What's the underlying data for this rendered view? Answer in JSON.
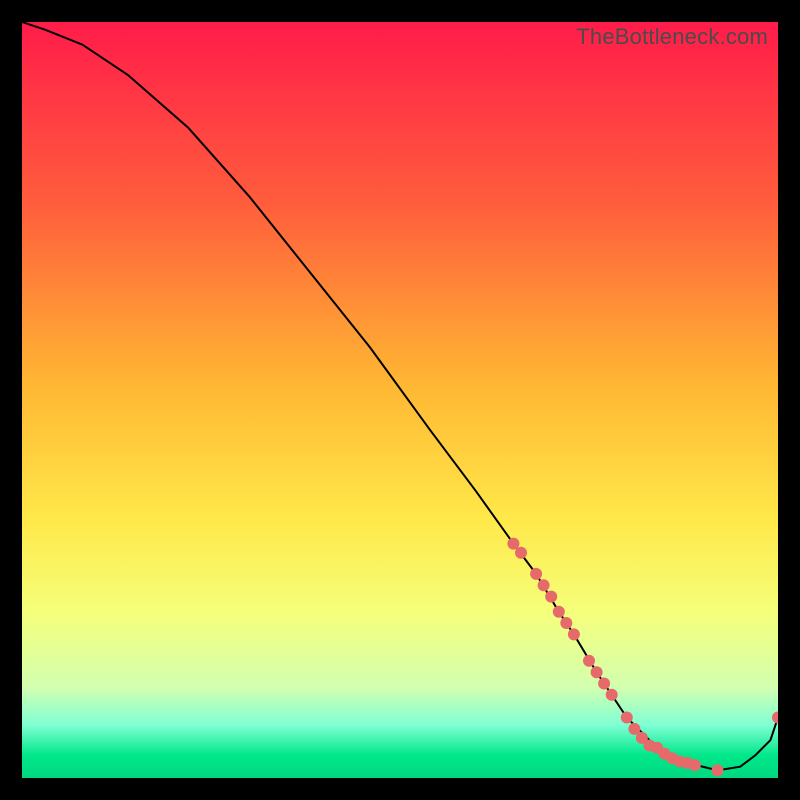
{
  "watermark": "TheBottleneck.com",
  "chart_data": {
    "type": "line",
    "title": "",
    "xlabel": "",
    "ylabel": "",
    "xlim": [
      0,
      100
    ],
    "ylim": [
      0,
      100
    ],
    "background_gradient": [
      "#ff1c4a",
      "#ff5d3c",
      "#ffb733",
      "#ffe94a",
      "#f5ff7a",
      "#d3ffb0",
      "#7fffd4",
      "#00e88a",
      "#00d880"
    ],
    "series": [
      {
        "name": "bottleneck-curve",
        "x": [
          0,
          3,
          8,
          14,
          22,
          30,
          38,
          46,
          54,
          60,
          65,
          68,
          71,
          73,
          76,
          80,
          84,
          88,
          92,
          95,
          97,
          99,
          100
        ],
        "y": [
          100,
          99,
          97,
          93,
          86,
          77,
          67,
          57,
          46,
          38,
          31,
          27,
          22,
          19,
          14,
          8,
          4,
          2,
          1,
          1.5,
          3,
          5,
          8
        ]
      }
    ],
    "highlight_points": {
      "name": "marked-range",
      "x": [
        65,
        66,
        68,
        69,
        70,
        71,
        72,
        73,
        75,
        76,
        77,
        78,
        80,
        81,
        82,
        83,
        84,
        85,
        86,
        87,
        88,
        89,
        92,
        100
      ],
      "y": [
        31,
        29.8,
        27,
        25.5,
        24,
        22,
        20.5,
        19,
        15.5,
        14,
        12.5,
        11,
        8,
        6.5,
        5.3,
        4.3,
        4,
        3.2,
        2.6,
        2.2,
        2,
        1.7,
        1,
        8
      ]
    }
  }
}
